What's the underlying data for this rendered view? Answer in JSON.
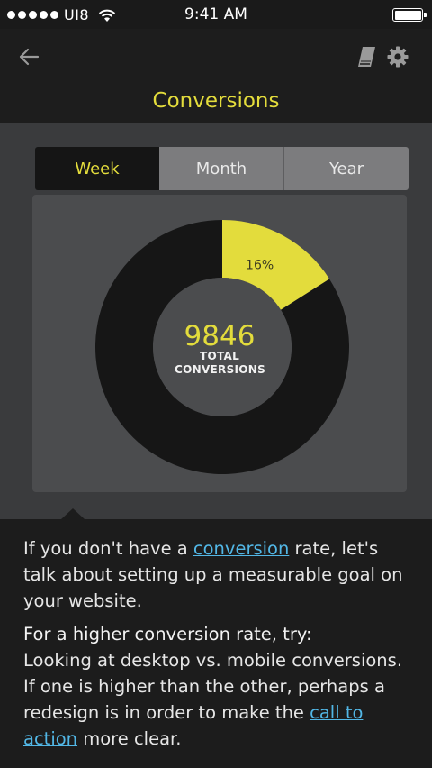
{
  "status_bar": {
    "carrier": "UI8",
    "time": "9:41 AM"
  },
  "header": {
    "title": "Conversions",
    "icons": [
      "back-arrow-icon",
      "book-icon",
      "gear-icon"
    ]
  },
  "tabs": [
    {
      "label": "Week",
      "active": true
    },
    {
      "label": "Month",
      "active": false
    },
    {
      "label": "Year",
      "active": false
    }
  ],
  "chart_data": {
    "type": "pie",
    "style": "donut",
    "slices": [
      {
        "label": "16%",
        "value": 16,
        "color": "#e3dc3c"
      },
      {
        "label": "",
        "value": 84,
        "color": "#161616"
      }
    ],
    "center_value": "9846",
    "center_label_line1": "TOTAL",
    "center_label_line2": "CONVERSIONS"
  },
  "info": {
    "intro_before": "If you don't have a ",
    "intro_link": "conversion",
    "intro_after": " rate, let's talk about setting up a measurable goal on your website.",
    "tip_heading": "For a higher conversion rate, try:",
    "tip_before": "Looking at desktop vs. mobile conversions. If one is higher than the other, perhaps a redesign is in order to make the ",
    "tip_link": "call to action",
    "tip_after": " more clear."
  },
  "colors": {
    "accent": "#e3dc3c",
    "link": "#52b7e6",
    "background": "#3a3b3d",
    "panel": "#1c1c1c"
  }
}
